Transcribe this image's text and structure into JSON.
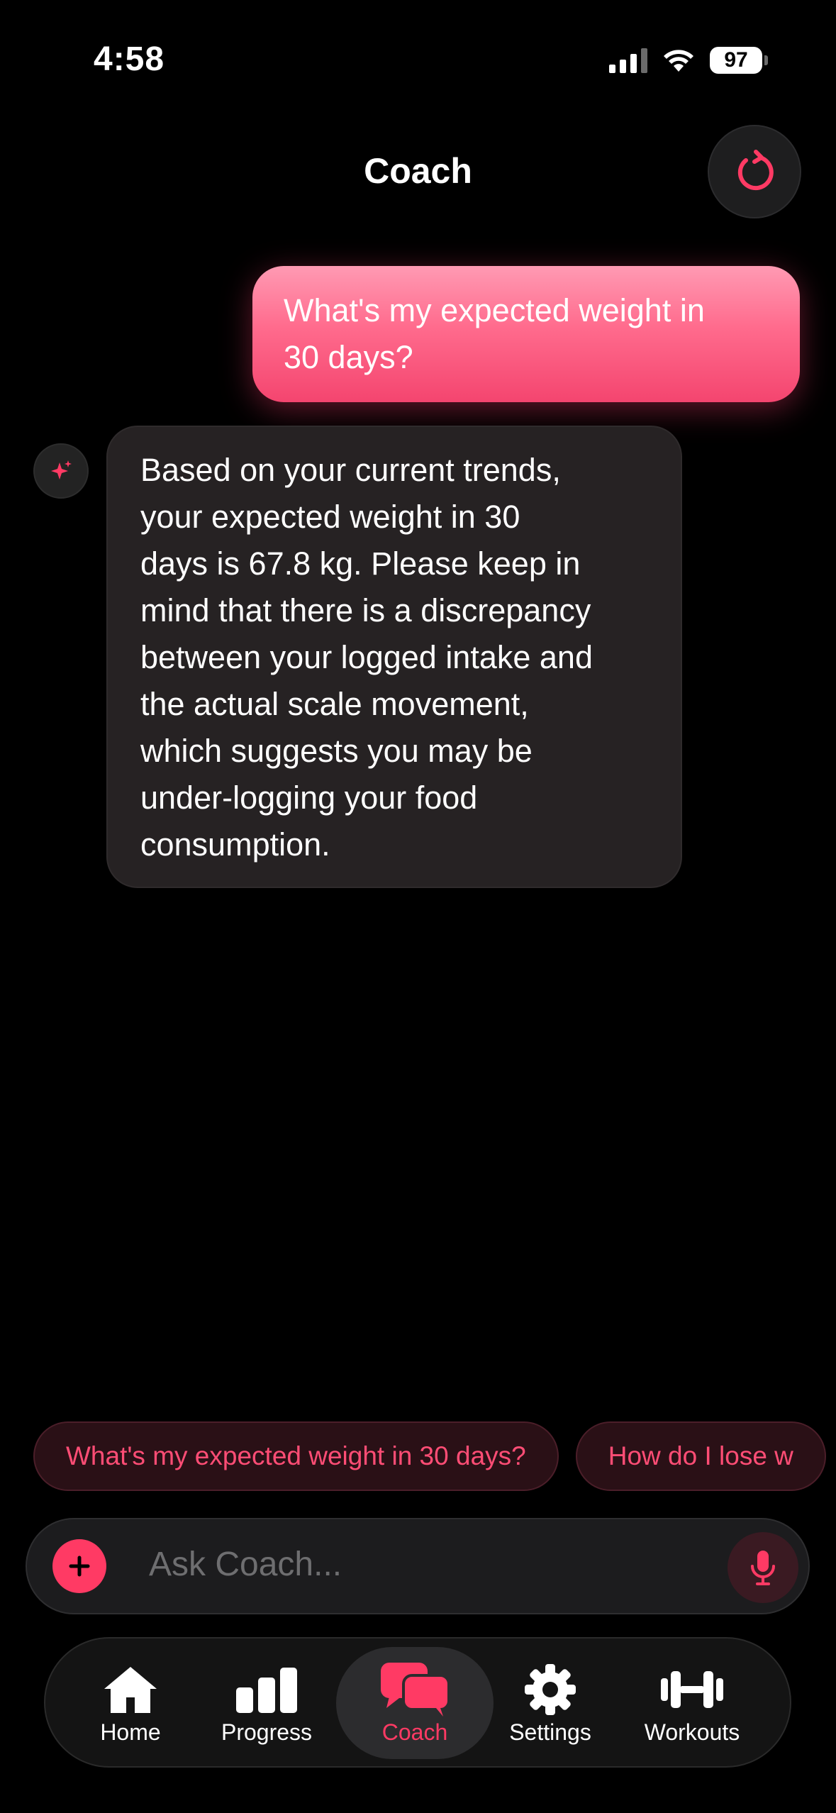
{
  "status": {
    "time": "4:58",
    "battery": "97"
  },
  "header": {
    "title": "Coach",
    "reset_icon": "reset-icon"
  },
  "messages": {
    "user": [
      "What's my expected weight in",
      "30 days?"
    ],
    "assistant": [
      "Based on your current trends,",
      "your expected weight in 30",
      "days is 67.8 kg. Please keep in",
      "mind that there is a discrepancy",
      "between your logged intake and",
      "the actual scale movement,",
      "which suggests you may be",
      "under-logging your food",
      "consumption."
    ]
  },
  "suggestions": [
    "What's my expected weight in 30 days?",
    "How do I lose w"
  ],
  "input": {
    "placeholder": "Ask Coach..."
  },
  "tabs": [
    {
      "label": "Home",
      "icon": "home-icon"
    },
    {
      "label": "Progress",
      "icon": "bar-chart-icon"
    },
    {
      "label": "Coach",
      "icon": "chat-bubbles-icon",
      "active": true
    },
    {
      "label": "Settings",
      "icon": "gear-icon"
    },
    {
      "label": "Workouts",
      "icon": "dumbbell-icon"
    }
  ],
  "colors": {
    "accent": "#ff3a64",
    "background": "#000000",
    "bubble_ai": "#262223"
  }
}
